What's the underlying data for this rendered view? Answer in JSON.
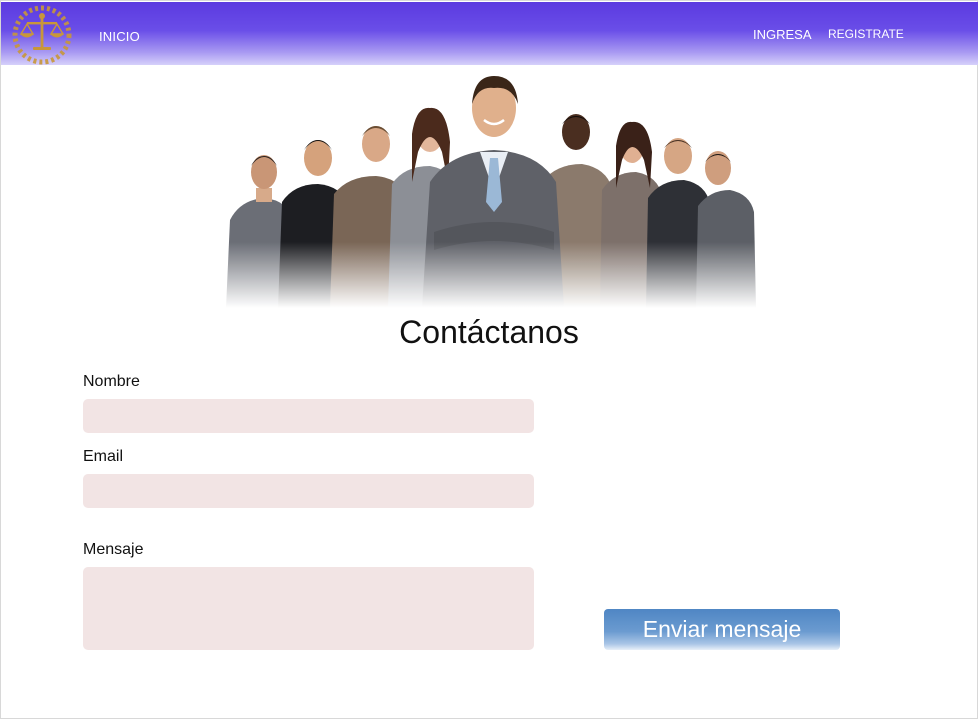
{
  "nav": {
    "logo_icon": "scales-of-justice-laurel-icon",
    "home_label": "INICIO",
    "login_label": "INGRESA",
    "register_label": "REGISTRATE"
  },
  "hero": {
    "image_description_icon": "business-team-photo"
  },
  "contact": {
    "title": "Contáctanos",
    "name_label": "Nombre",
    "email_label": "Email",
    "message_label": "Mensaje",
    "name_value": "",
    "email_value": "",
    "message_value": "",
    "send_label": "Enviar mensaje"
  },
  "colors": {
    "nav_top": "#5b3ae0",
    "field_bg": "#f2e4e4",
    "button": "#5a8dc8",
    "logo_gold": "#c8973a"
  }
}
